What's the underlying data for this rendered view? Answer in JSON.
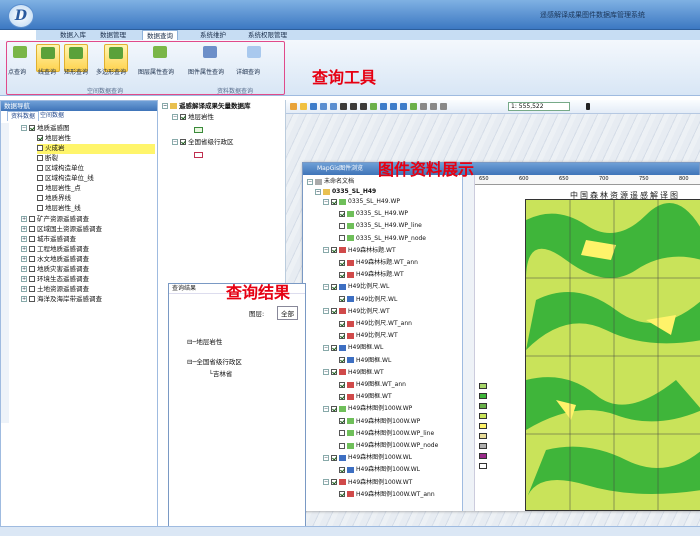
{
  "app": {
    "title": "遥感解译成果图件数据库管理系统",
    "logo_text": "D"
  },
  "menus": [
    "数据入库",
    "数据管理",
    "数据查询",
    "系统维护",
    "系统权限管理"
  ],
  "active_menu": "数据查询",
  "ribbon": {
    "buttons": [
      "点查询",
      "线查询",
      "矩形查询",
      "多边形查询",
      "图层属性查询",
      "图件属性查询",
      "详细查询"
    ],
    "groups": [
      "空间数据查询",
      "资料数据查询"
    ]
  },
  "annotations": {
    "tools": "查询工具",
    "display": "图件资料展示",
    "results": "查询结果"
  },
  "left_pane": {
    "header": "数据导航",
    "tabs": [
      "资料数据",
      "空间数据"
    ],
    "tree": [
      "地质遥感图",
      "地层岩性",
      "火成岩",
      "断裂",
      "区域构造单位",
      "区域构造单位_线",
      "地层岩性_点",
      "地质界线",
      "地层岩性_线",
      "矿产资源遥感调查",
      "区域国土资源遥感调查",
      "城市遥感调查",
      "工程地质遥感调查",
      "水文地质遥感调查",
      "地质灾害遥感调查",
      "环境生态遥感调查",
      "土地资源遥感调查",
      "海洋及海岸带遥感调查"
    ]
  },
  "mid_pane": {
    "header": "遥感解译成果矢量数据库",
    "items": [
      "地层岩性",
      "全国省级行政区"
    ]
  },
  "map_tool": {
    "coord": "1: 555,522"
  },
  "mapgis": {
    "title": "MapGis图件浏览",
    "root": "未命名文档",
    "doc": "0335_SL_H49",
    "layers": [
      "0335_SL_H49.WP",
      "0335_SL_H49.WP",
      "0335_SL_H49.WP_line",
      "0335_SL_H49.WP_node",
      "H49森林标题.WT",
      "H49森林标题.WT_ann",
      "H49森林标题.WT",
      "H49比例尺.WL",
      "H49比例尺.WL",
      "H49比例尺.WT",
      "H49比例尺.WT_ann",
      "H49比例尺.WT",
      "H49图框.WL",
      "H49图框.WL",
      "H49图框.WT",
      "H49图框.WT_ann",
      "H49图框.WT",
      "H49森林图例100W.WP",
      "H49森林图例100W.WP",
      "H49森林图例100W.WP_line",
      "H49森林图例100W.WP_node",
      "H49森林图例100W.WL",
      "H49森林图例100W.WL",
      "H49森林图例100W.WT",
      "H49森林图例100W.WT_ann"
    ],
    "ruler": [
      "650",
      "600",
      "650",
      "700",
      "750",
      "800"
    ],
    "map_title": "中国森林资源遥感解译图"
  },
  "result": {
    "header": "查询结果",
    "layer_label": "图层:",
    "layer_value": "全部",
    "items": [
      "地层岩性",
      "全国省级行政区",
      "吉林省"
    ]
  },
  "colors": {
    "accent": "#3f74b8",
    "highlight": "#fff56b",
    "red": "#e60012",
    "forest": "#c9e35a"
  }
}
